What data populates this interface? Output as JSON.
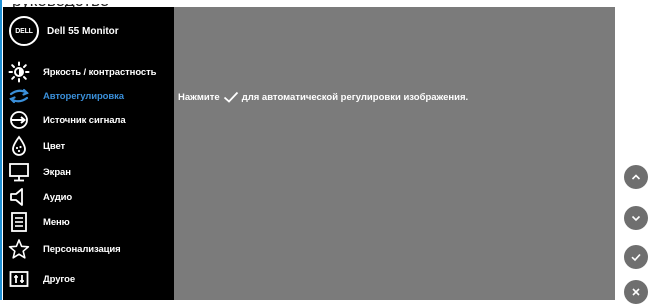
{
  "top_text": "руководство",
  "header": {
    "logo_text": "DELL",
    "model": "Dell 55 Monitor"
  },
  "menu": {
    "items": [
      {
        "label": "Яркость / контрастность",
        "icon": "brightness-icon",
        "active": false
      },
      {
        "label": "Авторегулировка",
        "icon": "auto-adjust-icon",
        "active": true
      },
      {
        "label": "Источник сигнала",
        "icon": "input-source-icon",
        "active": false
      },
      {
        "label": "Цвет",
        "icon": "color-icon",
        "active": false
      },
      {
        "label": "Экран",
        "icon": "display-icon",
        "active": false
      },
      {
        "label": "Аудио",
        "icon": "audio-icon",
        "active": false
      },
      {
        "label": "Меню",
        "icon": "menu-icon",
        "active": false
      },
      {
        "label": "Персонализация",
        "icon": "star-icon",
        "active": false
      },
      {
        "label": "Другое",
        "icon": "other-icon",
        "active": false
      }
    ]
  },
  "content": {
    "message_before": "Нажмите",
    "message_after": "для автоматической регулировки изображения."
  },
  "nav_buttons": [
    {
      "name": "up-button",
      "icon": "chevron-up-icon"
    },
    {
      "name": "down-button",
      "icon": "chevron-down-icon"
    },
    {
      "name": "ok-button",
      "icon": "check-icon"
    },
    {
      "name": "exit-button",
      "icon": "close-icon"
    }
  ],
  "colors": {
    "menu_bg": "#000000",
    "content_bg": "#7b7b7b",
    "active_label": "#3a8fd9",
    "button_bg": "#6f6f6f"
  }
}
